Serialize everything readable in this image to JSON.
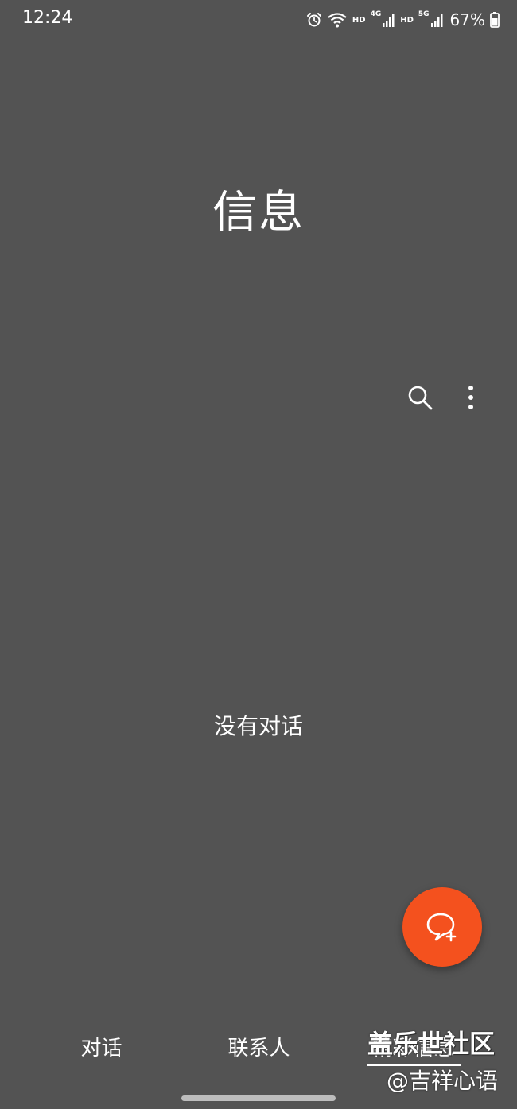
{
  "status_bar": {
    "time": "12:24",
    "hd_label_1": "HD",
    "net_1": "4G",
    "hd_label_2": "HD",
    "net_2": "5G",
    "battery": "67%"
  },
  "title": "信息",
  "toolbar": {
    "search_icon": "search-icon",
    "more_icon": "more-vertical-icon"
  },
  "empty_state": "没有对话",
  "fab": {
    "icon": "new-message-icon",
    "color": "#f4511e"
  },
  "bottom_nav": {
    "tabs": [
      {
        "label": "对话"
      },
      {
        "label": "联系人"
      },
      {
        "label": "精彩信息"
      }
    ]
  },
  "watermark": {
    "line1": "盖乐世社区",
    "line2": "@吉祥心语"
  },
  "colors": {
    "background": "#535353",
    "accent": "#f4511e"
  }
}
